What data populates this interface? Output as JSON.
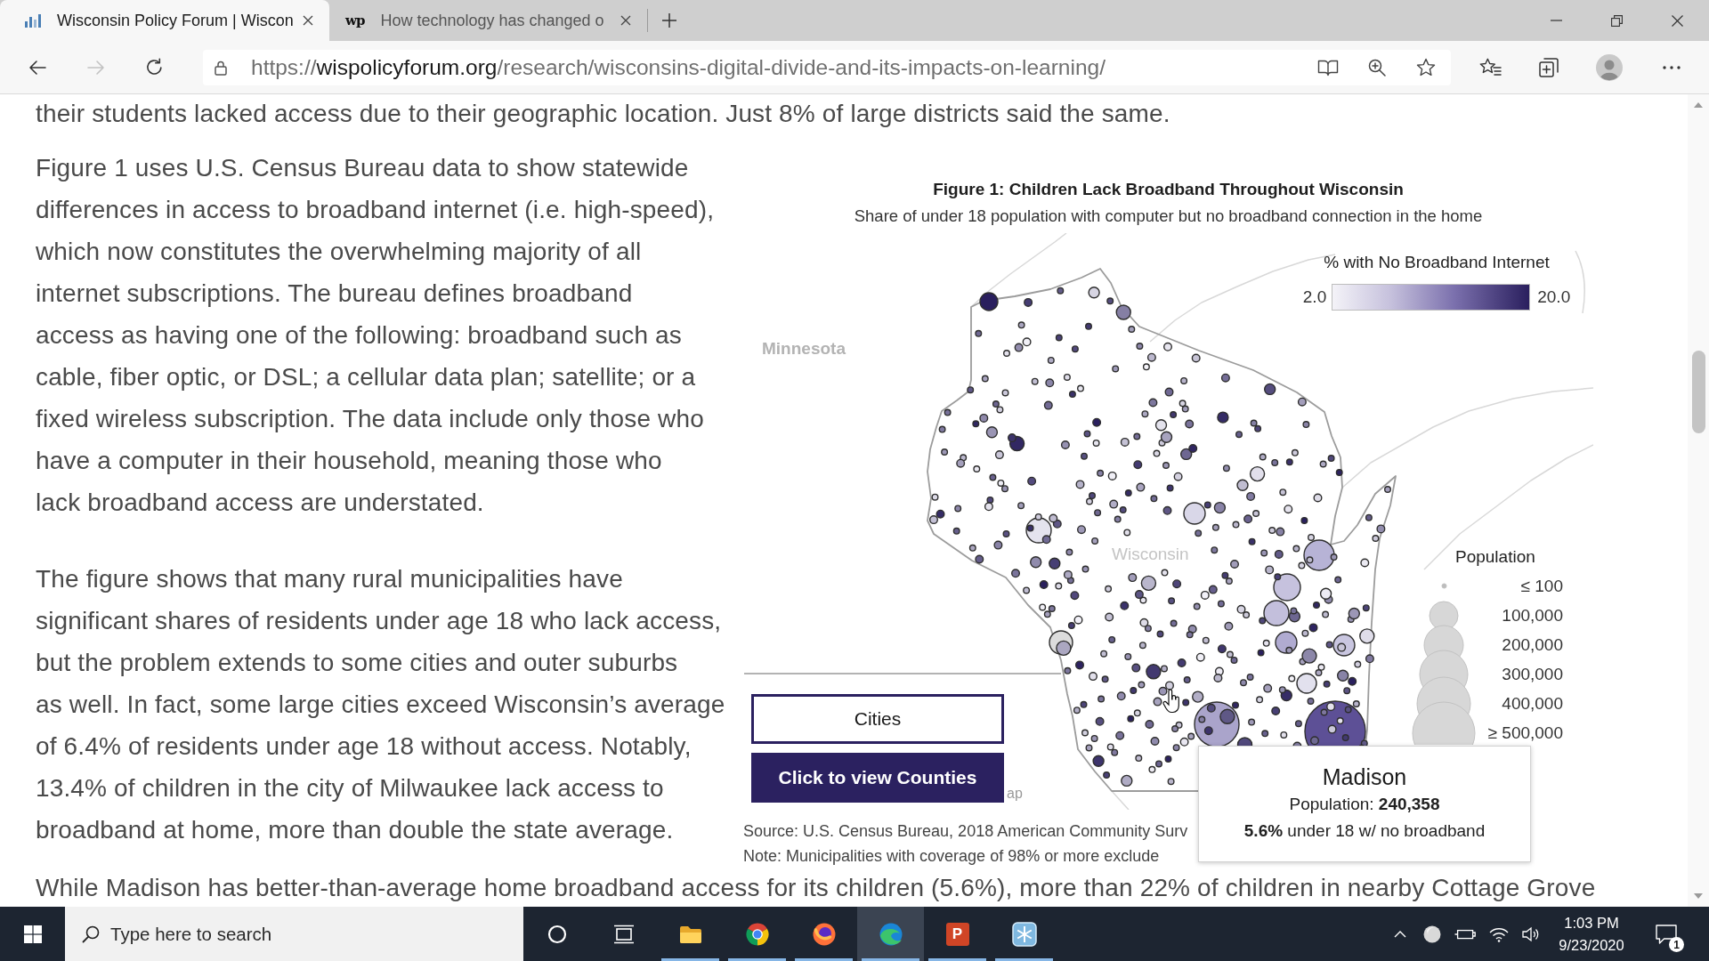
{
  "browser": {
    "tabs": [
      {
        "title": "Wisconsin Policy Forum | Wiscon",
        "favicon": {
          "kind": "chart"
        },
        "selected": true
      },
      {
        "title": "How technology has changed o",
        "favicon": {
          "kind": "letters",
          "text": "wp"
        },
        "selected": false
      }
    ],
    "forward_disabled": true,
    "url": {
      "scheme": "https://",
      "domain": "wispolicyforum.org",
      "path": "/research/wisconsins-digital-divide-and-its-impacts-on-learning/"
    }
  },
  "article": {
    "top_line": "their students lacked access due to their geographic location. Just 8% of large districts said the same.",
    "paragraphs": [
      "Figure 1 uses U.S. Census Bureau data to show statewide\ndifferences in access to broadband internet (i.e. high-speed),\nwhich now constitutes the overwhelming majority of all\ninternet subscriptions. The bureau defines broadband\naccess as having one of the following: broadband such as\ncable, fiber optic, or DSL; a cellular data plan; satellite; or a\nfixed wireless subscription. The data include only those who\nhave a computer in their household, meaning those who\nlack broadband access are understated.",
      "The figure shows that many rural municipalities have\nsignificant shares of residents under age 18 who lack access,\nbut the problem extends to some cities and outer suburbs\nas well. In fact, some large cities exceed Wisconsin’s average\nof 6.4% of residents under age 18 without access. Notably,\n13.4% of children in the city of Milwaukee lack access to\nbroadband at home, more than double the state average."
    ],
    "bottom_line": "While Madison has better-than-average home broadband access for its children (5.6%), more than 22% of children in nearby Cottage Grove"
  },
  "figure": {
    "title": "Figure 1: Children Lack Broadband Throughout Wisconsin",
    "subtitle": "Share of under 18 population with computer but no broadband connection in the home",
    "place_labels": [
      {
        "text": "Minnesota",
        "kind": "neighbor"
      },
      {
        "text": "Wisconsin",
        "kind": "state"
      }
    ],
    "color_legend": {
      "title": "% with No Broadband Internet",
      "min": "2.0",
      "max": "20.0"
    },
    "size_legend": {
      "title": "Population",
      "items": [
        "≤ 100",
        "100,000",
        "200,000",
        "300,000",
        "400,000",
        "≥ 500,000"
      ]
    },
    "view_buttons": [
      {
        "label": "Cities",
        "selected": true
      },
      {
        "label": "Click to view Counties",
        "selected": false
      }
    ],
    "attribution": "ap",
    "source": "Source: U.S. Census Bureau, 2018 American Community Surv",
    "note": "Note: Municipalities with coverage of 98% or more exclude",
    "tooltip": {
      "title": "Madison",
      "population": "Population: **240,358**",
      "share": "**5.6%** under 18 w/ no broadband"
    }
  },
  "taskbar": {
    "search": {
      "placeholder": "Type here to search"
    },
    "apps": [
      {
        "kind": "cortana",
        "running": false,
        "selected": false
      },
      {
        "kind": "task-view",
        "running": false,
        "selected": false
      },
      {
        "kind": "file-explorer",
        "running": true,
        "selected": false
      },
      {
        "kind": "chrome",
        "running": true,
        "selected": false
      },
      {
        "kind": "firefox",
        "running": true,
        "selected": false
      },
      {
        "kind": "edge",
        "running": true,
        "selected": true
      },
      {
        "kind": "powerpoint",
        "glyph": "P",
        "running": true,
        "selected": false
      },
      {
        "kind": "snowflake",
        "running": true,
        "selected": false
      }
    ],
    "time": "1:03 PM",
    "date": "9/23/2020",
    "notifications": "1"
  }
}
